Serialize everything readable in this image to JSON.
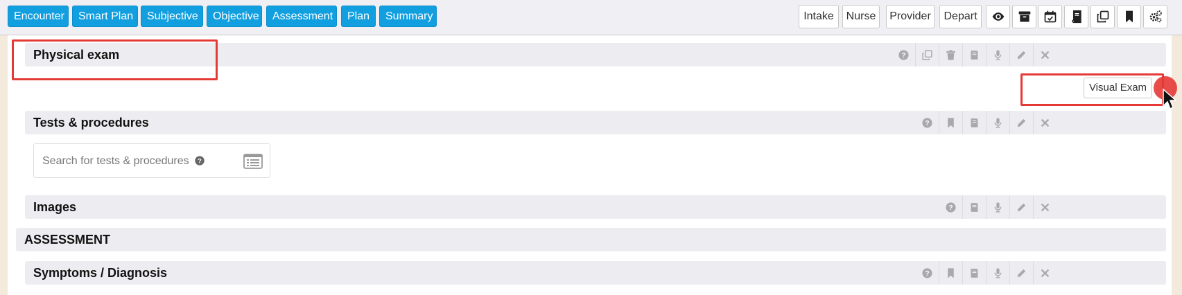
{
  "toolbar": {
    "tabs": [
      "Encounter",
      "Smart Plan",
      "Subjective",
      "Objective",
      "Assessment",
      "Plan",
      "Summary"
    ],
    "roles": [
      "Intake",
      "Nurse",
      "Provider",
      "Depart"
    ],
    "icons": [
      "eye-icon",
      "archive-icon",
      "calendar-check-icon",
      "book-icon",
      "copy-icon",
      "bookmark-icon",
      "gears-icon"
    ]
  },
  "sections": {
    "physical_exam": "Physical exam",
    "tests_procedures": "Tests & procedures",
    "images": "Images",
    "assessment_header": "ASSESSMENT",
    "symptoms_diagnosis": "Symptoms / Diagnosis"
  },
  "tooltip": {
    "visual_exam": "Visual Exam"
  },
  "search": {
    "placeholder": "Search for tests & procedures"
  },
  "colors": {
    "tab_blue": "#119fe0",
    "highlight_red": "#e53935",
    "section_gray": "#ededf1",
    "margin_tan": "#f3eadb"
  }
}
